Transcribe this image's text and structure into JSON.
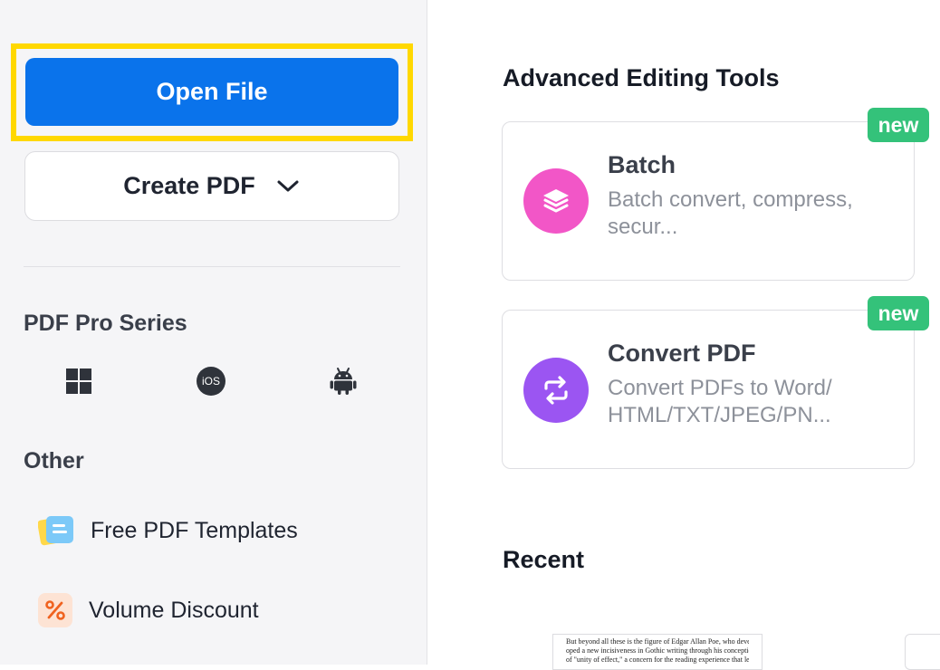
{
  "sidebar": {
    "open_file_label": "Open File",
    "create_pdf_label": "Create PDF",
    "pro_series_title": "PDF Pro Series",
    "platforms": [
      {
        "name": "windows-icon"
      },
      {
        "name": "ios-icon",
        "text": "iOS"
      },
      {
        "name": "android-icon"
      }
    ],
    "other_title": "Other",
    "other_items": [
      {
        "label": "Free PDF Templates",
        "icon": "templates-icon"
      },
      {
        "label": "Volume Discount",
        "icon": "discount-icon"
      }
    ]
  },
  "main": {
    "tools_title": "Advanced Editing Tools",
    "tools": [
      {
        "title": "Batch",
        "description": "Batch convert, compress, secur...",
        "badge": "new",
        "icon": "layers-icon",
        "color": "#f256c7"
      },
      {
        "title": "Convert PDF",
        "description": "Convert PDFs to Word/ HTML/TXT/JPEG/PN...",
        "badge": "new",
        "icon": "convert-icon",
        "color": "#9b55f2"
      }
    ],
    "recent_title": "Recent",
    "recent_preview_lines": [
      "But beyond all these is the figure of Edgar Allan Poe, who devel-",
      "oped a new incisiveness in Gothic writing through his conception",
      "of \"unity of effect,\" a concern for the reading experience that left a"
    ]
  },
  "colors": {
    "primary": "#0a73eb",
    "highlight": "#ffd800",
    "badge": "#34c27a"
  }
}
